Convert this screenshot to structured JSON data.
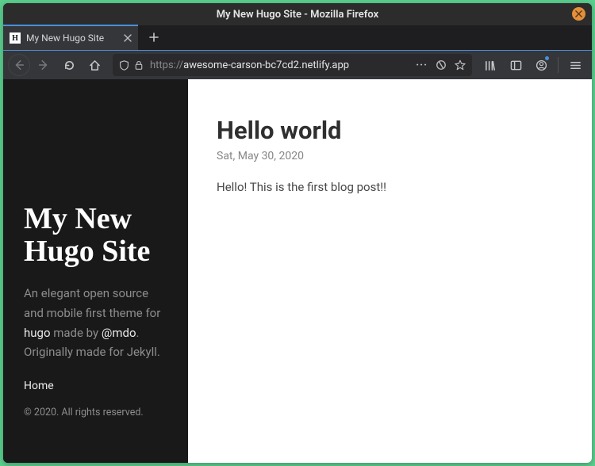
{
  "window": {
    "title": "My New Hugo Site - Mozilla Firefox"
  },
  "tab": {
    "title": "My New Hugo Site",
    "favicon_letter": "H"
  },
  "url": {
    "protocol": "https://",
    "rest": "awesome-carson-bc7cd2.netlify.app"
  },
  "sidebar": {
    "title": "My New Hugo Site",
    "lead_pre": "An elegant open source and mobile first theme for ",
    "link1": "hugo",
    "lead_mid": " made by ",
    "link2": "@mdo",
    "lead_post": ". Originally made for Jekyll.",
    "home": "Home",
    "copyright": "© 2020. All rights reserved."
  },
  "post": {
    "title": "Hello world",
    "date": "Sat, May 30, 2020",
    "body": "Hello! This is the first blog post!!"
  }
}
